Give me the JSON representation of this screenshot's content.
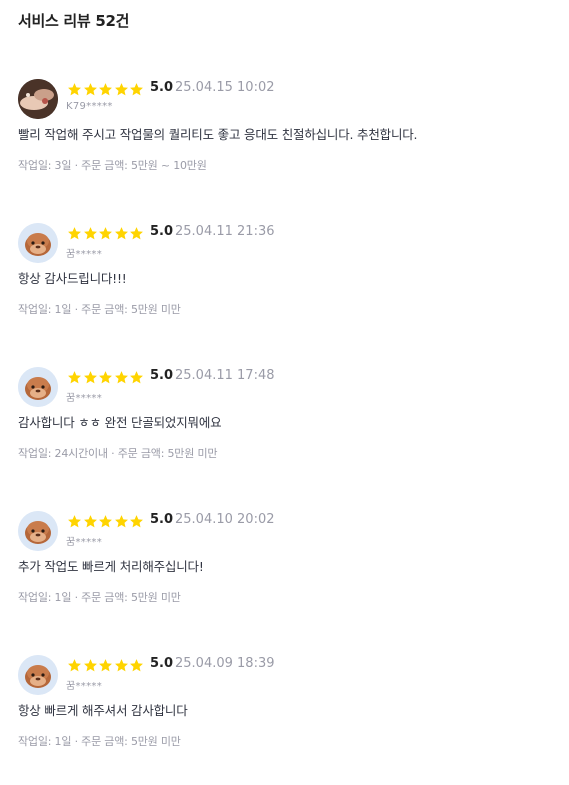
{
  "header": {
    "title": "서비스 리뷰 52건"
  },
  "colors": {
    "star": "#FFD400",
    "muted": "#9a9ba7",
    "text": "#303441"
  },
  "reviews": [
    {
      "avatar": "photo-avatar",
      "rating": "5.0",
      "stars": 5,
      "date": "25.04.15 10:02",
      "user": "K79*****",
      "text": "빨리 작업해 주시고 작업물의 퀄리티도 좋고 응대도 친절하십니다. 추천합니다.",
      "meta": "작업일: 3일 · 주문 금액: 5만원 ~ 10만원"
    },
    {
      "avatar": "mascot-avatar",
      "rating": "5.0",
      "stars": 5,
      "date": "25.04.11 21:36",
      "user": "꿈*****",
      "text": "항상 감사드립니다!!!",
      "meta": "작업일: 1일 · 주문 금액: 5만원 미만"
    },
    {
      "avatar": "mascot-avatar",
      "rating": "5.0",
      "stars": 5,
      "date": "25.04.11 17:48",
      "user": "꿈*****",
      "text": "감사합니다 ㅎㅎ 완전 단골되었지뭐에요",
      "meta": "작업일: 24시간이내 · 주문 금액: 5만원 미만"
    },
    {
      "avatar": "mascot-avatar",
      "rating": "5.0",
      "stars": 5,
      "date": "25.04.10 20:02",
      "user": "꿈*****",
      "text": "추가 작업도 빠르게 처리해주십니다!",
      "meta": "작업일: 1일 · 주문 금액: 5만원 미만"
    },
    {
      "avatar": "mascot-avatar",
      "rating": "5.0",
      "stars": 5,
      "date": "25.04.09 18:39",
      "user": "꿈*****",
      "text": "항상 빠르게 해주셔서 감사합니다",
      "meta": "작업일: 1일 · 주문 금액: 5만원 미만"
    }
  ]
}
